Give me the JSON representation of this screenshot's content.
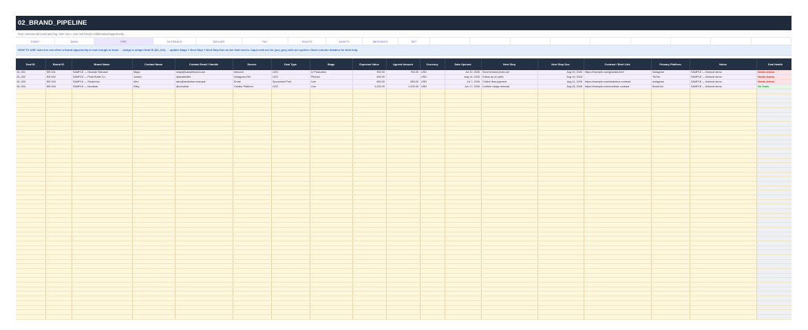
{
  "title": "02_BRAND_PIPELINE",
  "subtitle": "Your commercial command log. One row = one real brand collaboration/opportunity.",
  "nav": [
    "START",
    "DASH",
    "PIPE",
    "OUTREACH",
    "DELIVER",
    "PAY",
    "RIGHTS",
    "ASSETS",
    "MESSAGES",
    "SET"
  ],
  "nav_active": "PIPE",
  "howto": "HOW TO USE: Add one row when a brand opportunity is real enough to track → assign a unique Deal ID (DL-###) → update Stage + Next Step + Next Step Due as the deal moves. Input cells are for you; grey cells are system. Hover column headers for field help.",
  "columns": [
    "Deal ID",
    "Brand ID",
    "Brand Name",
    "Contact Name",
    "Contact Email / Handle",
    "Source",
    "Deal Type",
    "Stage",
    "Expected Value",
    "Agreed Amount",
    "Currency",
    "Date Opened",
    "Next Step",
    "Next Step Due",
    "Contract / Brief Link",
    "Primary Platform",
    "Notes",
    "Deal Health"
  ],
  "rows": [
    [
      "DL-001",
      "BR-001",
      "SAMPLE — Glowlab Skincare",
      "Maya",
      "maya@sampleband.com",
      "Inbound",
      "UGC",
      "In Production",
      "900.00",
      "750.00",
      "USD",
      "Jul 22, 2026",
      "Send revised photo set",
      "Aug 20, 2026",
      "https://example.com/glowlab-brief",
      "Instagram",
      "SAMPLE — fictional demo",
      "Needs Action"
    ],
    [
      "DL-002",
      "BR-002",
      "SAMPLE — Peak Bottle Co.",
      "Jordan",
      "@peakbottle",
      "Instagram DM",
      "UGC",
      "Pitched",
      "450.00",
      "",
      "USD",
      "Aug 14, 2026",
      "Follow up on pitch",
      "Aug 19, 2026",
      "",
      "TikTok",
      "SAMPLE — fictional demo",
      "Needs Action"
    ],
    [
      "DL-003",
      "BR-003",
      "SAMPLE — StudioHue",
      "Alex",
      "alex@studiohue.example",
      "Email",
      "Sponsored Post",
      "Live",
      "850.00",
      "850.00",
      "USD",
      "Jul 7, 2026",
      "Collect final payment",
      "Aug 11, 2026",
      "https://example.com/studiohue-contract",
      "Instagram",
      "SAMPLE — fictional demo",
      "Needs Action"
    ],
    [
      "DL-004",
      "BR-004",
      "SAMPLE — Novahair",
      "Riley",
      "@novahair",
      "Creator Platform",
      "UGC",
      "Live",
      "1,200.00",
      "1,200.00",
      "USD",
      "Jun 17, 2026",
      "Confirm usage removal",
      "Aug 28, 2026",
      "https://example.com/novahair-contract",
      "Brand Ad",
      "SAMPLE — fictional demo",
      "On Track"
    ]
  ],
  "colors": {
    "title_bg": "#1f2a3b",
    "header_bg": "#243044",
    "input_cell": "#fff7dc",
    "sample_row": "#f3eef9",
    "needs_action": "#d0261f",
    "on_track": "#1e8e2e",
    "accent": "#6b4fd8"
  }
}
